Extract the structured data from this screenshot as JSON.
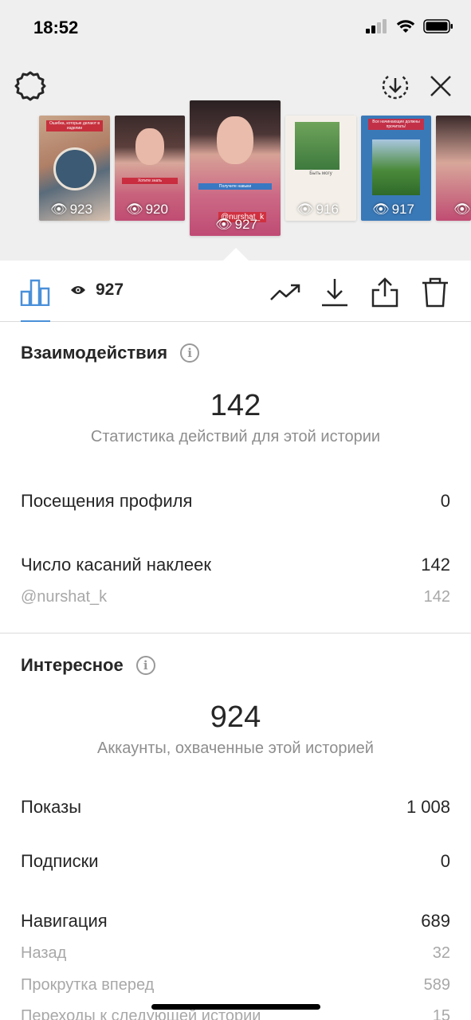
{
  "status": {
    "time": "18:52"
  },
  "thumbnails": [
    {
      "count": "923",
      "caption": "Ошибка, которые делают в изделии"
    },
    {
      "count": "920",
      "caption": "Хотите знать"
    },
    {
      "count": "927",
      "caption": "Получите навыки",
      "handle": "@nurshat_k"
    },
    {
      "count": "916",
      "caption": "Быть могу"
    },
    {
      "count": "917",
      "caption": "Все начинающие должны прочитать!"
    },
    {
      "count": ""
    }
  ],
  "toolbar": {
    "views": "927"
  },
  "interactions": {
    "title": "Взаимодействия",
    "total": "142",
    "total_label": "Статистика действий для этой истории",
    "rows": [
      {
        "label": "Посещения профиля",
        "value": "0"
      },
      {
        "label": "Число касаний наклеек",
        "value": "142"
      }
    ],
    "sub_rows": [
      {
        "label": "@nurshat_k",
        "value": "142"
      }
    ]
  },
  "discovery": {
    "title": "Интересное",
    "total": "924",
    "total_label": "Аккаунты, охваченные этой историей",
    "rows": [
      {
        "label": "Показы",
        "value": "1 008"
      },
      {
        "label": "Подписки",
        "value": "0"
      },
      {
        "label": "Навигация",
        "value": "689"
      }
    ],
    "sub_rows": [
      {
        "label": "Назад",
        "value": "32"
      },
      {
        "label": "Прокрутка вперед",
        "value": "589"
      },
      {
        "label": "Переходы к следующей истории",
        "value": "15"
      }
    ]
  }
}
